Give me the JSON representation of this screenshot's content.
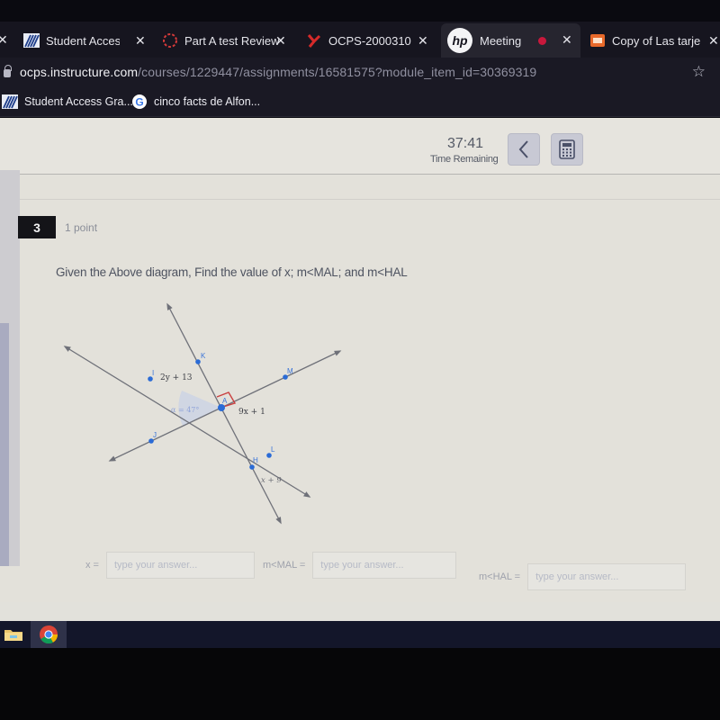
{
  "browser": {
    "tabs": [
      {
        "label": "Student Access S",
        "icon": "student-access-icon",
        "active": false
      },
      {
        "label": "Part A test Review",
        "icon": "loading-ring-icon",
        "active": false
      },
      {
        "label": "OCPS-2000310",
        "icon": "ocps-icon",
        "active": false
      },
      {
        "label": "Meeting",
        "icon": "hp-logo-icon",
        "active": true,
        "recording": true
      },
      {
        "label": "Copy of Las tarje",
        "icon": "slides-icon",
        "active": false
      }
    ],
    "close_glyph": "✕",
    "url_host": "ocps.instructure.com",
    "url_path": "/courses/1229447/assignments/16581575?module_item_id=30369319",
    "bookmarks": [
      {
        "label": "Student Access Gra...",
        "icon": "student-access-icon"
      },
      {
        "label": "cinco facts de Alfon...",
        "icon": "google-icon"
      }
    ]
  },
  "quiz": {
    "timer": {
      "value": "37:41",
      "label": "Time Remaining"
    },
    "question_number": "3",
    "points": "1 point",
    "question_text": "Given the Above diagram, Find the value of x; m<MAL; and m<HAL",
    "diagram": {
      "points": [
        "K",
        "I",
        "M",
        "A",
        "J",
        "L",
        "H"
      ],
      "labels": {
        "angle_IAK": "2y + 13",
        "angle_alpha": "α = 47°",
        "angle_MAL": "9x + 1",
        "angle_HAL": "x + 9"
      },
      "right_angle_at": "A",
      "colors": {
        "line": "#6f7179",
        "point": "#2a6bd6",
        "right_angle": "#c94040",
        "alpha_fill": "#c9d2e6"
      }
    },
    "answers": [
      {
        "label": "x =",
        "placeholder": "type your answer...",
        "value": ""
      },
      {
        "label": "m<MAL =",
        "placeholder": "type your answer...",
        "value": ""
      },
      {
        "label": "m<HAL =",
        "placeholder": "type your answer...",
        "value": ""
      }
    ]
  },
  "taskbar": {
    "items": [
      {
        "name": "file-explorer"
      },
      {
        "name": "chrome",
        "active": true
      }
    ]
  }
}
